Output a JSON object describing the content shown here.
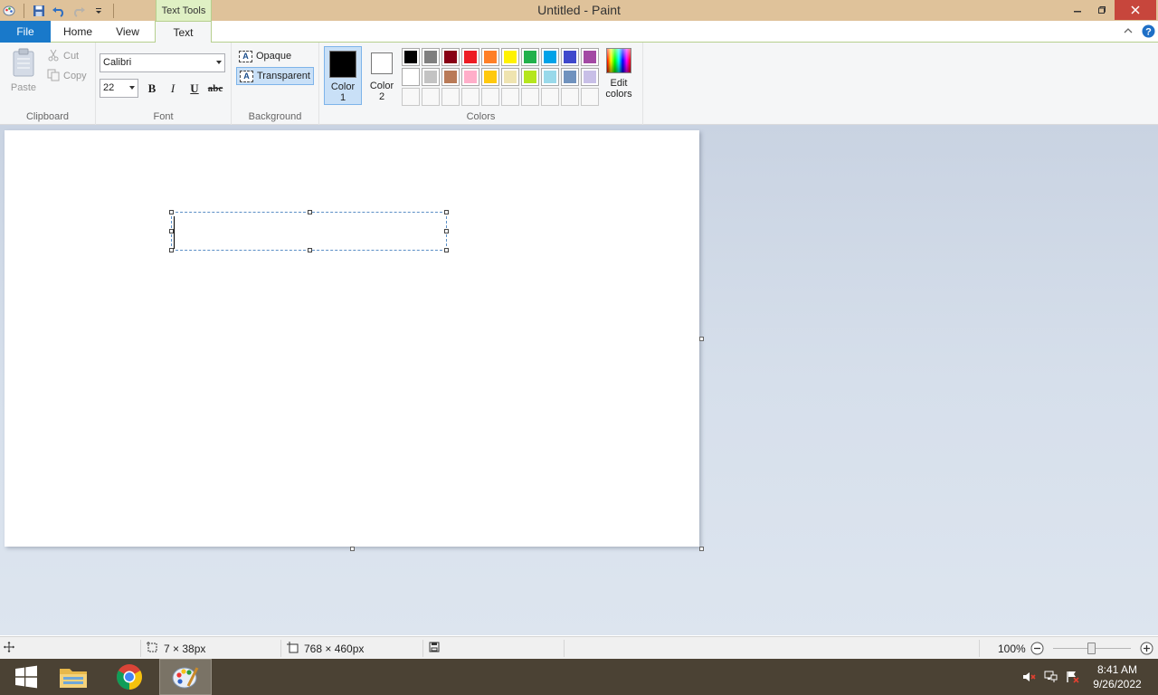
{
  "window": {
    "title": "Untitled - Paint",
    "contextual_tab_group": "Text Tools"
  },
  "ribbon_tabs": {
    "file": "File",
    "home": "Home",
    "view": "View",
    "text": "Text",
    "selected": "Text"
  },
  "clipboard": {
    "paste": "Paste",
    "cut": "Cut",
    "copy": "Copy",
    "label": "Clipboard"
  },
  "font": {
    "family": "Calibri",
    "size": "22",
    "bold": "B",
    "italic": "I",
    "underline": "U",
    "strikethrough": "abc",
    "label": "Font"
  },
  "background": {
    "opaque": "Opaque",
    "transparent": "Transparent",
    "selected": "Transparent",
    "label": "Background"
  },
  "colors": {
    "color1_label_a": "Color",
    "color1_label_b": "1",
    "color2_label_a": "Color",
    "color2_label_b": "2",
    "color1_value": "#000000",
    "color2_value": "#ffffff",
    "palette_row1": [
      "#000000",
      "#7f7f7f",
      "#880015",
      "#ed1c24",
      "#ff7f27",
      "#fff200",
      "#22b14c",
      "#00a2e8",
      "#3f48cc",
      "#a349a4"
    ],
    "palette_row2": [
      "#ffffff",
      "#c3c3c3",
      "#b97a57",
      "#ffaec9",
      "#ffc90e",
      "#efe4b0",
      "#b5e61d",
      "#99d9ea",
      "#7092be",
      "#c8bfe7"
    ],
    "empty_slots": 10,
    "edit_a": "Edit",
    "edit_b": "colors",
    "label": "Colors"
  },
  "status": {
    "selection_size": "7 × 38px",
    "canvas_size": "768 × 460px",
    "zoom": "100%"
  },
  "taskbar": {
    "time": "8:41 AM",
    "date": "9/26/2022"
  }
}
